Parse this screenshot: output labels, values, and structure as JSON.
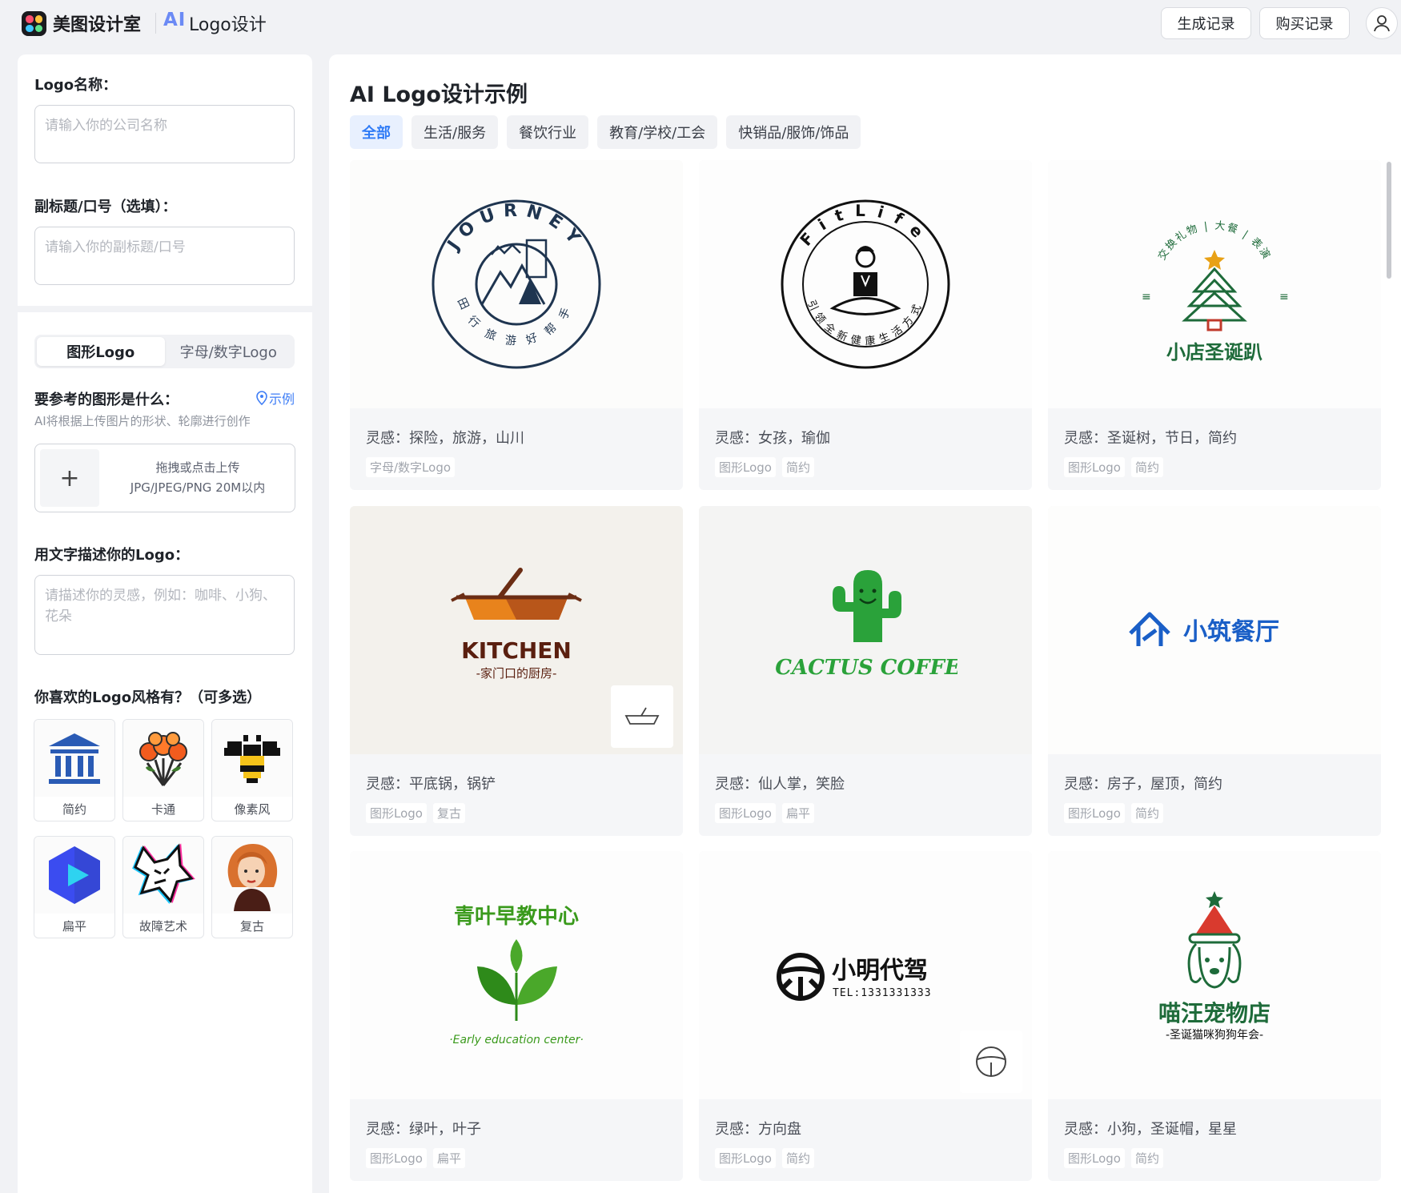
{
  "header": {
    "app_name": "美图设计室",
    "ai_label": "AI",
    "product_name": "Logo设计",
    "buttons": [
      "生成记录",
      "购买记录"
    ]
  },
  "form": {
    "name_label": "Logo名称：",
    "name_placeholder": "请输入你的公司名称",
    "subtitle_label": "副标题/口号（选填）：",
    "subtitle_placeholder": "请输入你的副标题/口号",
    "mode_tabs": [
      "图形Logo",
      "字母/数字Logo"
    ],
    "shape_label": "要参考的图形是什么：",
    "example_link": "示例",
    "shape_hint": "AI将根据上传图片的形状、轮廓进行创作",
    "upload_line1": "拖拽或点击上传",
    "upload_line2": "JPG/JPEG/PNG 20M以内",
    "describe_label": "用文字描述你的Logo：",
    "describe_placeholder": "请描述你的灵感，例如：咖啡、小狗、花朵",
    "style_label": "你喜欢的Logo风格有？（可多选）",
    "styles": [
      "简约",
      "卡通",
      "像素风",
      "扁平",
      "故障艺术",
      "复古"
    ]
  },
  "gallery": {
    "title": "AI Logo设计示例",
    "tabs": [
      "全部",
      "生活/服务",
      "餐饮行业",
      "教育/学校/工会",
      "快销品/服饰/饰品"
    ],
    "cards": [
      {
        "insp": "灵感：探险，旅游，山川",
        "tags": [
          "字母/数字Logo"
        ],
        "logo_text": "JOURNEY",
        "logo_sub": "田行旅游好帮手"
      },
      {
        "insp": "灵感：女孩，瑜伽",
        "tags": [
          "图形Logo",
          "简约"
        ],
        "logo_text": "FitLife",
        "logo_sub": "引领全新健康生活方式"
      },
      {
        "insp": "灵感：圣诞树，节日，简约",
        "tags": [
          "图形Logo",
          "简约"
        ],
        "logo_text": "小店圣诞趴",
        "logo_sub": "交换礼物 | 大餐 | 表演"
      },
      {
        "insp": "灵感：平底锅，锅铲",
        "tags": [
          "图形Logo",
          "复古"
        ],
        "logo_text": "KITCHEN",
        "logo_sub": "-家门口的厨房-"
      },
      {
        "insp": "灵感：仙人掌，笑脸",
        "tags": [
          "图形Logo",
          "扁平"
        ],
        "logo_text": "CACTUS COFFE"
      },
      {
        "insp": "灵感：房子，屋顶，简约",
        "tags": [
          "图形Logo",
          "简约"
        ],
        "logo_text": "小筑餐厅"
      },
      {
        "insp": "灵感：绿叶，叶子",
        "tags": [
          "图形Logo",
          "扁平"
        ],
        "logo_text": "青叶早教中心",
        "logo_sub": "·Early education center·"
      },
      {
        "insp": "灵感：方向盘",
        "tags": [
          "图形Logo",
          "简约"
        ],
        "logo_text": "小明代驾",
        "logo_sub": "TEL:1331331333"
      },
      {
        "insp": "灵感：小狗，圣诞帽，星星",
        "tags": [
          "图形Logo",
          "简约"
        ],
        "logo_text": "喵汪宠物店",
        "logo_sub": "-圣诞猫咪狗狗年会-"
      }
    ]
  }
}
